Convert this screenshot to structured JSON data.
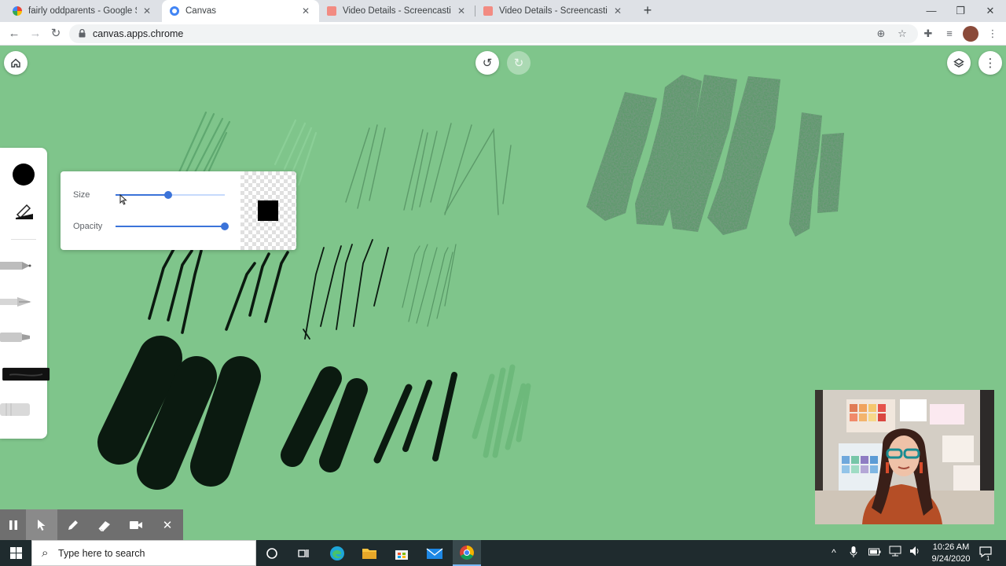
{
  "browser": {
    "tabs": [
      {
        "title": "fairly oddparents - Google Searc",
        "favicon": "google-icon",
        "active": false
      },
      {
        "title": "Canvas",
        "favicon": "canvas-icon",
        "active": true
      },
      {
        "title": "Video Details - Screencastify",
        "favicon": "screencastify-icon",
        "active": false
      },
      {
        "title": "Video Details - Screencastify",
        "favicon": "screencastify-icon",
        "active": false
      }
    ],
    "url": "canvas.apps.chrome"
  },
  "canvas": {
    "background_color": "#7fc58b",
    "brush_popup": {
      "size_label": "Size",
      "opacity_label": "Opacity",
      "size_value": 0.48,
      "opacity_value": 1.0,
      "selected_color": "#000000"
    }
  },
  "taskbar": {
    "search_placeholder": "Type here to search",
    "time": "10:26 AM",
    "date": "9/24/2020",
    "notifications": "1"
  }
}
